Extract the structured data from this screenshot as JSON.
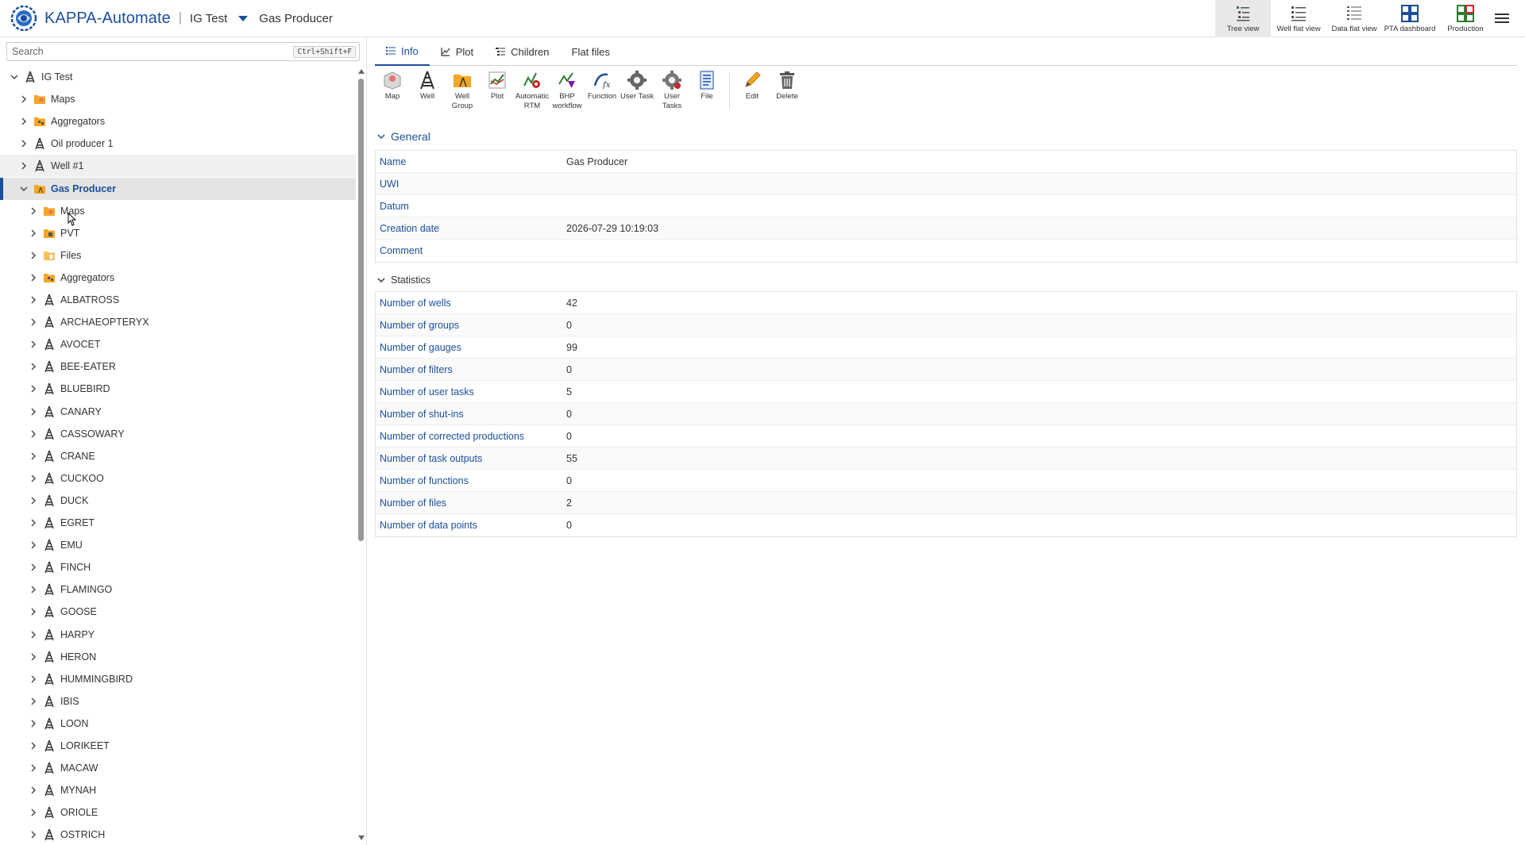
{
  "header": {
    "app_title": "KAPPA-Automate",
    "separator": "|",
    "project": "IG Test",
    "breadcrumb": "Gas Producer",
    "views": [
      {
        "label": "Tree view",
        "icon": "tree-view-icon",
        "active": true
      },
      {
        "label": "Well flat view",
        "icon": "well-flat-view-icon",
        "active": false
      },
      {
        "label": "Data flat view",
        "icon": "data-flat-view-icon",
        "active": false
      },
      {
        "label": "PTA dashboard",
        "icon": "pta-dashboard-icon",
        "active": false
      },
      {
        "label": "Production",
        "icon": "production-icon",
        "active": false
      }
    ]
  },
  "sidebar": {
    "search_placeholder": "Search",
    "search_shortcut": "Ctrl+Shift+F",
    "tree": [
      {
        "label": "IG Test",
        "level": 0,
        "icon": "well-icon",
        "expanded": true
      },
      {
        "label": "Maps",
        "level": 1,
        "icon": "maps-folder-icon",
        "expanded": false
      },
      {
        "label": "Aggregators",
        "level": 1,
        "icon": "aggregators-folder-icon",
        "expanded": false
      },
      {
        "label": "Oil producer 1",
        "level": 1,
        "icon": "well-icon",
        "expanded": false
      },
      {
        "label": "Well #1",
        "level": 1,
        "icon": "well-icon",
        "expanded": false,
        "hover": true
      },
      {
        "label": "Gas Producer",
        "level": 1,
        "icon": "well-group-icon",
        "expanded": true,
        "selected": true
      },
      {
        "label": "Maps",
        "level": 2,
        "icon": "maps-folder-icon",
        "expanded": false
      },
      {
        "label": "PVT",
        "level": 2,
        "icon": "pvt-folder-icon",
        "expanded": false
      },
      {
        "label": "Files",
        "level": 2,
        "icon": "files-folder-icon",
        "expanded": false
      },
      {
        "label": "Aggregators",
        "level": 2,
        "icon": "aggregators-folder-icon",
        "expanded": false
      },
      {
        "label": "ALBATROSS",
        "level": 2,
        "icon": "well-icon",
        "expanded": false
      },
      {
        "label": "ARCHAEOPTERYX",
        "level": 2,
        "icon": "well-icon",
        "expanded": false
      },
      {
        "label": "AVOCET",
        "level": 2,
        "icon": "well-icon",
        "expanded": false
      },
      {
        "label": "BEE-EATER",
        "level": 2,
        "icon": "well-icon",
        "expanded": false
      },
      {
        "label": "BLUEBIRD",
        "level": 2,
        "icon": "well-icon",
        "expanded": false
      },
      {
        "label": "CANARY",
        "level": 2,
        "icon": "well-icon",
        "expanded": false
      },
      {
        "label": "CASSOWARY",
        "level": 2,
        "icon": "well-icon",
        "expanded": false
      },
      {
        "label": "CRANE",
        "level": 2,
        "icon": "well-icon",
        "expanded": false
      },
      {
        "label": "CUCKOO",
        "level": 2,
        "icon": "well-icon",
        "expanded": false
      },
      {
        "label": "DUCK",
        "level": 2,
        "icon": "well-icon",
        "expanded": false
      },
      {
        "label": "EGRET",
        "level": 2,
        "icon": "well-icon",
        "expanded": false
      },
      {
        "label": "EMU",
        "level": 2,
        "icon": "well-icon",
        "expanded": false
      },
      {
        "label": "FINCH",
        "level": 2,
        "icon": "well-icon",
        "expanded": false
      },
      {
        "label": "FLAMINGO",
        "level": 2,
        "icon": "well-icon",
        "expanded": false
      },
      {
        "label": "GOOSE",
        "level": 2,
        "icon": "well-icon",
        "expanded": false
      },
      {
        "label": "HARPY",
        "level": 2,
        "icon": "well-icon",
        "expanded": false
      },
      {
        "label": "HERON",
        "level": 2,
        "icon": "well-icon",
        "expanded": false
      },
      {
        "label": "HUMMINGBIRD",
        "level": 2,
        "icon": "well-icon",
        "expanded": false
      },
      {
        "label": "IBIS",
        "level": 2,
        "icon": "well-icon",
        "expanded": false
      },
      {
        "label": "LOON",
        "level": 2,
        "icon": "well-icon",
        "expanded": false
      },
      {
        "label": "LORIKEET",
        "level": 2,
        "icon": "well-icon",
        "expanded": false
      },
      {
        "label": "MACAW",
        "level": 2,
        "icon": "well-icon",
        "expanded": false
      },
      {
        "label": "MYNAH",
        "level": 2,
        "icon": "well-icon",
        "expanded": false
      },
      {
        "label": "ORIOLE",
        "level": 2,
        "icon": "well-icon",
        "expanded": false
      },
      {
        "label": "OSTRICH",
        "level": 2,
        "icon": "well-icon",
        "expanded": false
      }
    ]
  },
  "main": {
    "tabs": [
      {
        "label": "Info",
        "icon": "list-icon",
        "active": true
      },
      {
        "label": "Plot",
        "icon": "plot-icon",
        "active": false
      },
      {
        "label": "Children",
        "icon": "children-icon",
        "active": false
      },
      {
        "label": "Flat files",
        "icon": "",
        "active": false
      }
    ],
    "toolbar": [
      {
        "label": "Map",
        "icon": "map-icon"
      },
      {
        "label": "Well",
        "icon": "well-icon"
      },
      {
        "label": "Well Group",
        "icon": "well-group-icon"
      },
      {
        "label": "Plot",
        "icon": "plot-icon"
      },
      {
        "label": "Automatic RTM",
        "icon": "automatic-rtm-icon"
      },
      {
        "label": "BHP workflow",
        "icon": "bhp-workflow-icon"
      },
      {
        "label": "Function",
        "icon": "function-icon"
      },
      {
        "label": "User Task",
        "icon": "user-task-icon"
      },
      {
        "label": "User Tasks",
        "icon": "user-tasks-icon"
      },
      {
        "label": "File",
        "icon": "file-icon"
      },
      {
        "label": "Edit",
        "icon": "edit-icon"
      },
      {
        "label": "Delete",
        "icon": "delete-icon"
      }
    ],
    "general": {
      "title": "General",
      "rows": [
        {
          "key": "Name",
          "value": "Gas Producer"
        },
        {
          "key": "UWI",
          "value": ""
        },
        {
          "key": "Datum",
          "value": ""
        },
        {
          "key": "Creation date",
          "value": "2026-07-29 10:19:03"
        },
        {
          "key": "Comment",
          "value": ""
        }
      ]
    },
    "statistics": {
      "title": "Statistics",
      "rows": [
        {
          "key": "Number of wells",
          "value": "42"
        },
        {
          "key": "Number of groups",
          "value": "0"
        },
        {
          "key": "Number of gauges",
          "value": "99"
        },
        {
          "key": "Number of filters",
          "value": "0"
        },
        {
          "key": "Number of user tasks",
          "value": "5"
        },
        {
          "key": "Number of shut-ins",
          "value": "0"
        },
        {
          "key": "Number of corrected productions",
          "value": "0"
        },
        {
          "key": "Number of task outputs",
          "value": "55"
        },
        {
          "key": "Number of functions",
          "value": "0"
        },
        {
          "key": "Number of files",
          "value": "2"
        },
        {
          "key": "Number of data points",
          "value": "0"
        }
      ]
    }
  },
  "colors": {
    "accent": "#1b4f9b",
    "folder": "#f5a623"
  }
}
